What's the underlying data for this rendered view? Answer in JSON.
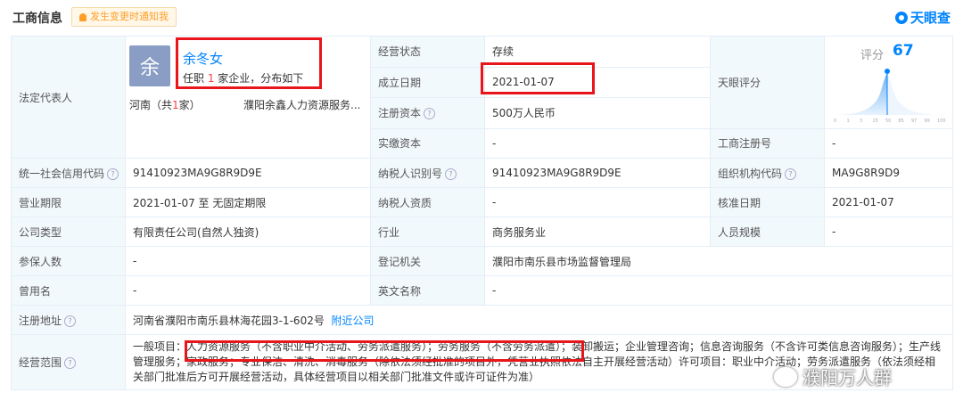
{
  "header": {
    "title": "工商信息",
    "notify_label": "发生变更时通知我",
    "brand": "天眼查"
  },
  "labels": {
    "legal_rep": "法定代表人",
    "status": "经营状态",
    "established": "成立日期",
    "reg_capital": "注册资本",
    "paid_capital": "实缴资本",
    "credit_code": "统一社会信用代码",
    "taxpayer_id": "纳税人识别号",
    "org_code": "组织机构代码",
    "term": "营业期限",
    "taxpayer_qual": "纳税人资质",
    "approval_date": "核准日期",
    "company_type": "公司类型",
    "industry": "行业",
    "staff_size": "人员规模",
    "insured": "参保人数",
    "registry": "登记机关",
    "former_name": "曾用名",
    "english_name": "英文名称",
    "address": "注册地址",
    "scope": "经营范围",
    "tianyan_score": "天眼评分",
    "biz_reg_no": "工商注册号"
  },
  "rep": {
    "avatar_char": "余",
    "name": "余冬女",
    "sub_pre": "任职 ",
    "sub_count": "1",
    "sub_post": " 家企业，分布如下",
    "prov_pre": "河南（共",
    "prov_count": "1",
    "prov_post": "家）",
    "company": "濮阳余鑫人力资源服务..."
  },
  "values": {
    "status": "存续",
    "established": "2021-01-07",
    "reg_capital": "500万人民币",
    "paid_capital": "-",
    "biz_reg_no": "-",
    "credit_code": "91410923MA9G8R9D9E",
    "taxpayer_id": "91410923MA9G8R9D9E",
    "org_code": "MA9G8R9D9",
    "term": "2021-01-07  至 无固定期限",
    "taxpayer_qual": "-",
    "approval_date": "2021-01-07",
    "company_type": "有限责任公司(自然人独资)",
    "industry": "商务服务业",
    "staff_size": "-",
    "insured": "-",
    "registry": "濮阳市南乐县市场监督管理局",
    "former_name": "-",
    "english_name": "-",
    "address": "河南省濮阳市南乐县林海花园3-1-602号",
    "nearby_link": "附近公司",
    "scope": "一般项目：人力资源服务（不含职业中介活动、劳务派遣服务）；劳务服务（不含劳务派遣）；装卸搬运；企业管理咨询；信息咨询服务（不含许可类信息咨询服务）；生产线管理服务；家政服务；专业保洁、清洗、消毒服务（除依法须经批准的项目外，凭营业执照依法自主开展经营活动）许可项目：职业中介活动；劳务派遣服务（依法须经相关部门批准后方可开展经营活动，具体经营项目以相关部门批准文件或许可证件为准）"
  },
  "score": {
    "label": "评分",
    "value": "67",
    "ticks": [
      "0",
      "1",
      "3",
      "15",
      "50",
      "85",
      "97",
      "99",
      "100"
    ]
  },
  "watermark": "濮阳万人群",
  "colors": {
    "accent": "#0084ff",
    "highlight_box": "#e8161b",
    "label_bg": "#f2f9fc",
    "border": "#e4eef6"
  }
}
